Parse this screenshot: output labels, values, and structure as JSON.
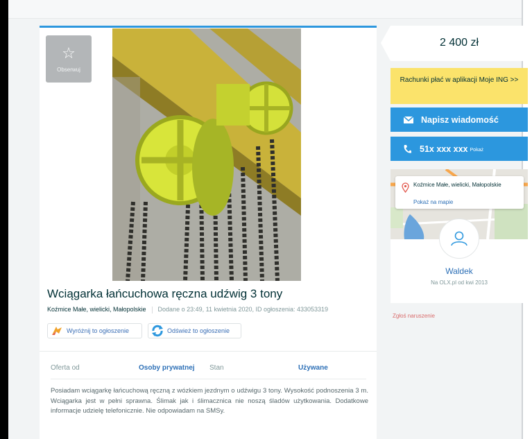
{
  "top": {
    "faint_text": ""
  },
  "listing": {
    "observe_label": "Obserwuj",
    "title": "Wciągarka łańcuchowa ręczna udźwig 3 tony",
    "location": "Koźmice Małe, wielicki, Małopolskie",
    "added": "Dodane o 23:49, 11 kwietnia 2020, ID ogłoszenia: 433053319",
    "promote_label": "Wyróżnij to ogłoszenie",
    "refresh_label": "Odśwież to ogłoszenie",
    "params": [
      {
        "key": "Oferta od",
        "value": "Osoby prywatnej"
      },
      {
        "key": "Stan",
        "value": "Używane"
      }
    ],
    "description": "Posiadam wciągarkę łańcuchową ręczną z wózkiem jezdnym o udźwigu 3 tony. Wysokość podnoszenia 3 m. Wciągarka jest w pełni sprawna. Ślimak jak i ślimacznica nie noszą śladów użytkowania. Dodatkowe informacje udzielę telefonicznie. Nie odpowiadam na SMSy."
  },
  "sidebar": {
    "price": "2 400 zł",
    "ing_banner": "Rachunki płać w aplikacji Moje ING >>",
    "message_button": "Napisz wiadomość",
    "phone_number": "51x xxx xxx",
    "phone_show": "Pokaż",
    "map_location": "Koźmice Małe, wielicki, Małopolskie",
    "map_link": "Pokaż na mapie",
    "user_name": "Waldek",
    "user_since": "Na OLX.pl od kwi 2013",
    "report": "Zgłoś naruszenie"
  },
  "colors": {
    "accent_blue": "#2c97de",
    "link_blue": "#2c6fb6",
    "ing_yellow": "#fbe36b",
    "text_dark": "#002f34",
    "report_red": "#d96b6b"
  },
  "icons": [
    "star-icon",
    "envelope-icon",
    "phone-icon",
    "location-pin-icon",
    "user-icon",
    "promote-icon",
    "refresh-icon"
  ]
}
